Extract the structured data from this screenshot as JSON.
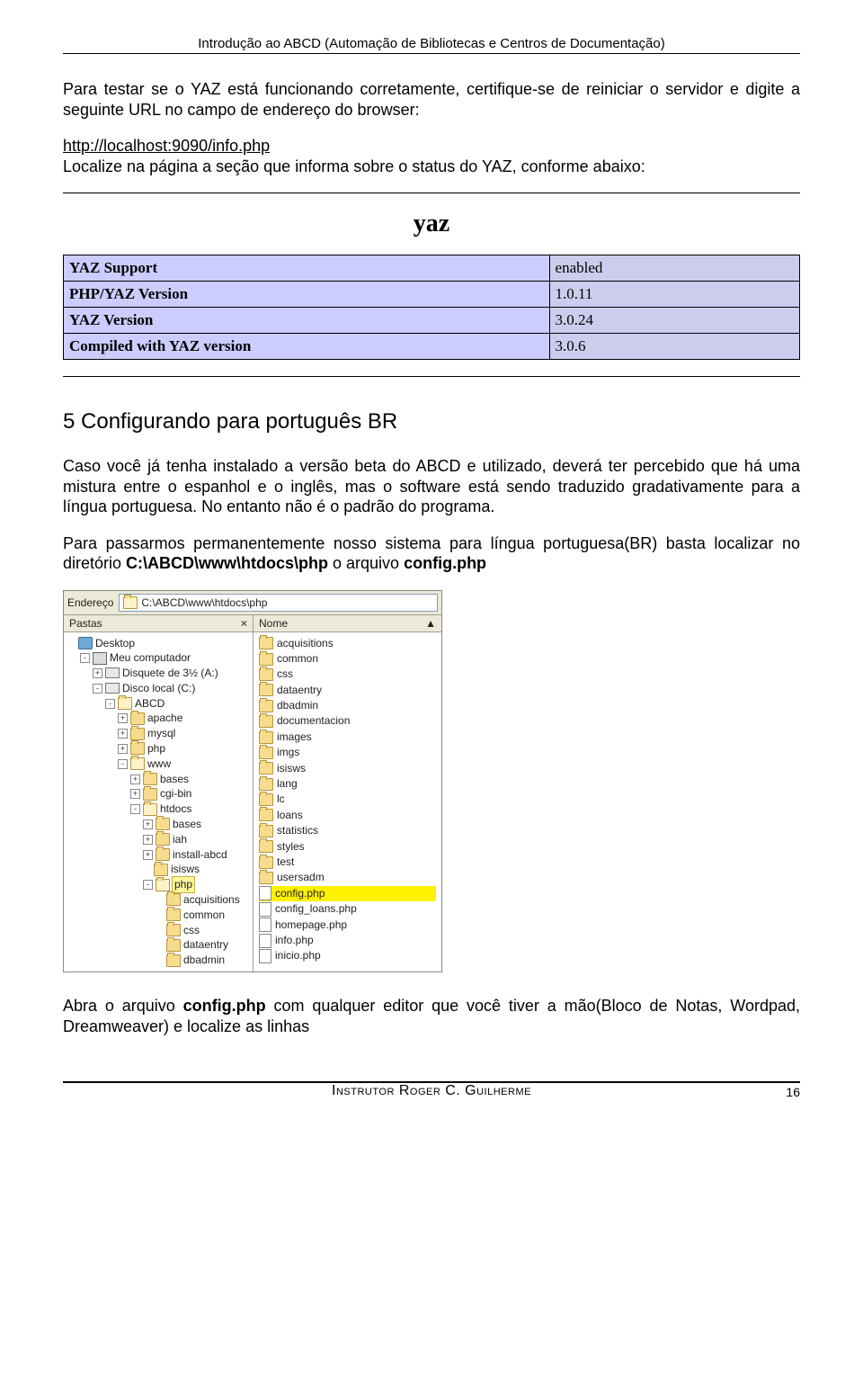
{
  "header": "Introdução ao ABCD (Automação de Bibliotecas e Centros de Documentação)",
  "intro": {
    "p1": "Para testar se o YAZ está funcionando corretamente, certifique-se de reiniciar o servidor e digite a seguinte URL no campo de endereço do browser:",
    "url": "http://localhost:9090/info.php",
    "p2": "Localize na página a seção que informa sobre o status do YAZ, conforme abaixo:"
  },
  "yaz": {
    "title": "yaz",
    "rows": [
      {
        "label": "YAZ Support",
        "value": "enabled"
      },
      {
        "label": "PHP/YAZ Version",
        "value": "1.0.11"
      },
      {
        "label": "YAZ Version",
        "value": "3.0.24"
      },
      {
        "label": "Compiled with YAZ version",
        "value": "3.0.6"
      }
    ]
  },
  "section5": {
    "title": "5 Configurando para português BR",
    "p1": "Caso você já tenha instalado a versão beta do ABCD e utilizado, deverá ter percebido que há uma mistura entre o espanhol e o inglês, mas o software está sendo traduzido gradativamente para a língua portuguesa. No entanto não é o padrão do programa.",
    "p2a": "Para passarmos permanentemente nosso sistema para língua portuguesa(BR) basta localizar no diretório ",
    "p2path": "C:\\ABCD\\www\\htdocs\\php",
    "p2b": " o arquivo ",
    "p2file": "config.php"
  },
  "explorer": {
    "address_label": "Endereço",
    "address_value": "C:\\ABCD\\www\\htdocs\\php",
    "folders_label": "Pastas",
    "nome_label": "Nome",
    "tree": {
      "desktop": "Desktop",
      "mycomputer": "Meu computador",
      "floppy": "Disquete de 3½ (A:)",
      "disk": "Disco local (C:)",
      "abcd": "ABCD",
      "abcd_children": [
        "apache",
        "mysql",
        "php",
        "www"
      ],
      "www_children": [
        "bases",
        "cgi-bin",
        "htdocs"
      ],
      "htdocs_children": [
        "bases",
        "iah",
        "install-abcd",
        "isisws",
        "php"
      ],
      "php_children": [
        "acquisitions",
        "common",
        "css",
        "dataentry",
        "dbadmin"
      ]
    },
    "files": {
      "folders": [
        "acquisitions",
        "common",
        "css",
        "dataentry",
        "dbadmin",
        "documentacion",
        "images",
        "imgs",
        "isisws",
        "lang",
        "lc",
        "loans",
        "statistics",
        "styles",
        "test",
        "usersadm"
      ],
      "files": [
        "config.php",
        "config_loans.php",
        "homepage.php",
        "info.php",
        "inicio.php"
      ],
      "highlighted": "config.php"
    }
  },
  "closing": {
    "a": "Abra o arquivo ",
    "file": "config.php",
    "b": " com qualquer editor que você tiver a mão(Bloco de Notas, Wordpad, Dreamweaver) e localize as linhas"
  },
  "footer": {
    "instructor": "Instrutor Roger C. Guilherme",
    "page": "16"
  }
}
